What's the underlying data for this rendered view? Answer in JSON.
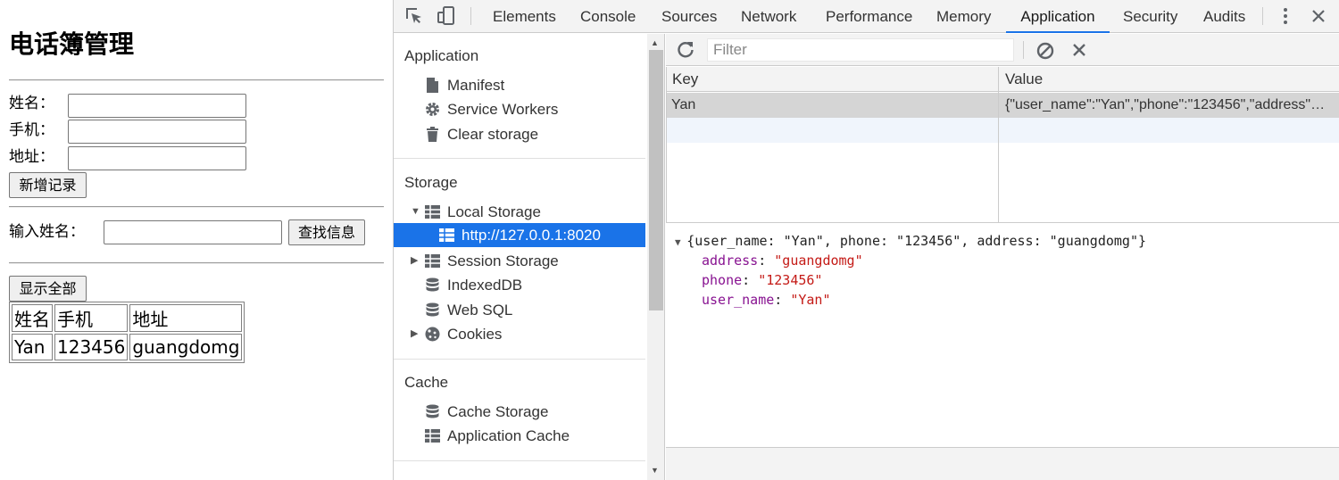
{
  "page": {
    "title": "电话簿管理",
    "form": {
      "name_label": "姓名：",
      "phone_label": "手机：",
      "address_label": "地址：",
      "name_value": "",
      "phone_value": "",
      "address_value": "",
      "add_button": "新增记录"
    },
    "search": {
      "label": "输入姓名：",
      "value": "",
      "button": "查找信息"
    },
    "show_all_button": "显示全部",
    "table": {
      "headers": [
        "姓名",
        "手机",
        "地址"
      ],
      "rows": [
        [
          "Yan",
          "123456",
          "guangdomg"
        ]
      ]
    }
  },
  "devtools": {
    "tabs": [
      "Elements",
      "Console",
      "Sources",
      "Network",
      "Performance",
      "Memory",
      "Application",
      "Security",
      "Audits"
    ],
    "active_tab": "Application",
    "accent_color": "#1a73e8",
    "sidebar": {
      "application_title": "Application",
      "application_items": [
        "Manifest",
        "Service Workers",
        "Clear storage"
      ],
      "storage_title": "Storage",
      "local_storage": "Local Storage",
      "local_storage_origin": "http://127.0.0.1:8020",
      "storage_items": [
        "Session Storage",
        "IndexedDB",
        "Web SQL",
        "Cookies"
      ],
      "cache_title": "Cache",
      "cache_items": [
        "Cache Storage",
        "Application Cache"
      ]
    },
    "filter_placeholder": "Filter",
    "kv": {
      "key_header": "Key",
      "value_header": "Value",
      "rows": [
        {
          "key": "Yan",
          "value": "{\"user_name\":\"Yan\",\"phone\":\"123456\",\"address\":\"guangdomg\"}"
        }
      ]
    },
    "preview": {
      "summary": "{user_name: \"Yan\", phone: \"123456\", address: \"guangdomg\"}",
      "props": [
        {
          "key": "address",
          "value": "\"guangdomg\""
        },
        {
          "key": "phone",
          "value": "\"123456\""
        },
        {
          "key": "user_name",
          "value": "\"Yan\""
        }
      ]
    }
  }
}
